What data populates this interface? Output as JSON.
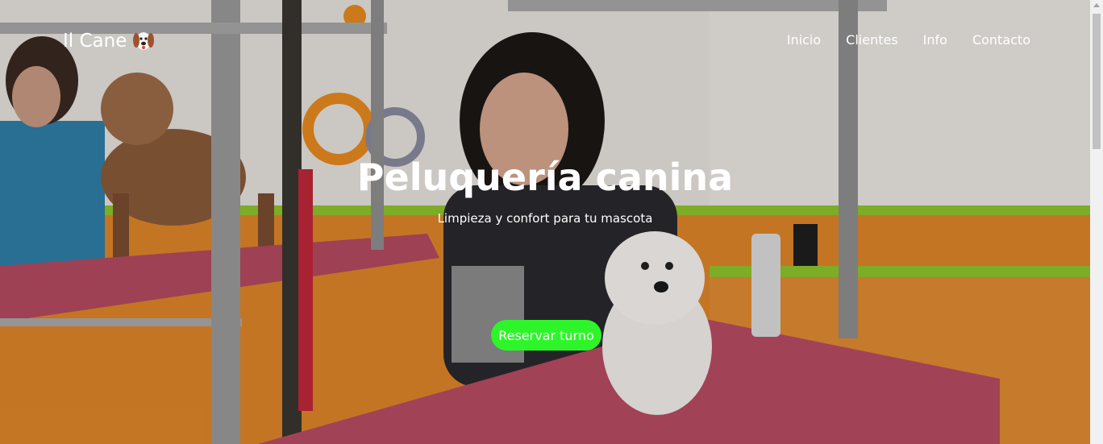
{
  "brand": {
    "name": "Il Cane",
    "icon": "dog-face-icon"
  },
  "nav": {
    "items": [
      "Inicio",
      "Clientes",
      "Info",
      "Contacto"
    ]
  },
  "hero": {
    "title": "Peluquería canina",
    "subtitle": "Limpieza y confort para tu mascota",
    "cta_label": "Reservar turno"
  },
  "colors": {
    "cta": "#2ef52a",
    "text": "#ffffff",
    "table": "#b8405a"
  }
}
